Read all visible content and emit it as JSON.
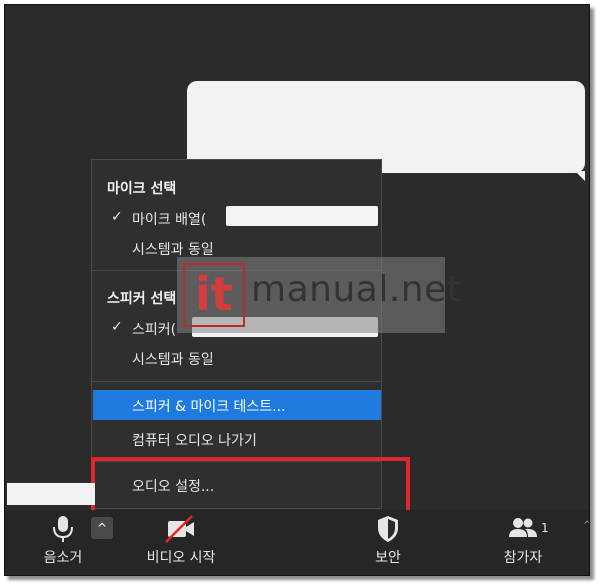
{
  "menu": {
    "mic_section": "마이크 선택",
    "mic_items": [
      "마이크 배열(",
      "시스템과 동일"
    ],
    "speaker_section": "스피커 선택",
    "speaker_items": [
      "스피커(",
      "시스템과 동일"
    ],
    "check_glyph": "✓",
    "test_item": "스피커 & 마이크 테스트...",
    "leave_audio": "컴퓨터 오디오 나가기",
    "audio_settings": "오디오 설정..."
  },
  "toolbar": {
    "mute": "음소거",
    "video": "비디오 시작",
    "security": "보안",
    "participants": "참가자",
    "participant_count": "1",
    "caret": "^"
  },
  "watermark": {
    "logo": "it",
    "text": "manual.net"
  },
  "colors": {
    "highlight": "#1f7ae0",
    "red_box": "#e0262b",
    "background": "#2b2b2b"
  }
}
